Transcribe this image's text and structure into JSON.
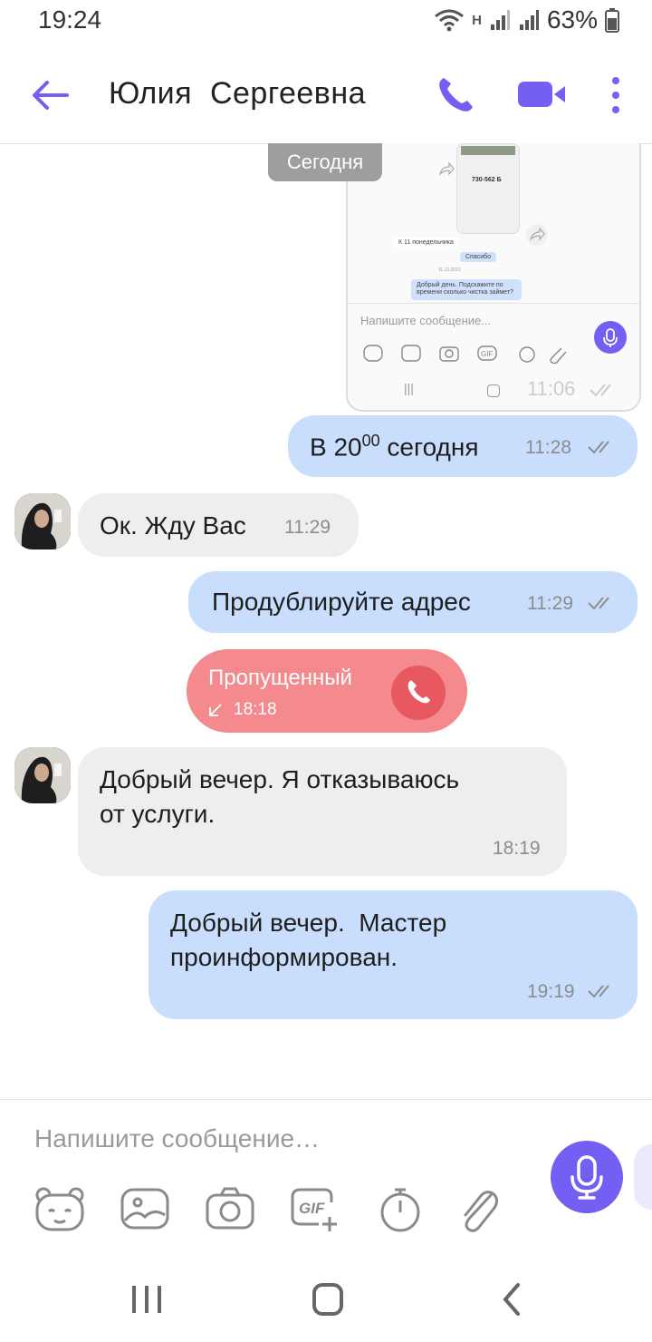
{
  "status_bar": {
    "time": "19:24",
    "battery": "63%",
    "network_label": "H"
  },
  "header": {
    "contact_name": "Юлия  Сергеевна"
  },
  "date_chip": "Сегодня",
  "attachment": {
    "messages": [
      "К 11 понедельника",
      "Спасибо",
      "Добрый день. Подскажите по времени сколько чистка займет?"
    ],
    "price": "730-562 Б",
    "date_label": "11.12.2021",
    "input_placeholder": "Напишите сообщение...",
    "timestamp": "11:06"
  },
  "messages": [
    {
      "direction": "out",
      "text_main": "В 20",
      "text_sup": "00",
      "text_rest": " сегодня",
      "time": "11:28"
    },
    {
      "direction": "in",
      "text": "Ок. Жду Вас",
      "time": "11:29"
    },
    {
      "direction": "out",
      "text": "Продублируйте адрес",
      "time": "11:29"
    },
    {
      "direction": "missed_call",
      "label": "Пропущенный",
      "time": "18:18"
    },
    {
      "direction": "in",
      "text_line1": "Добрый вечер. Я отказываюсь",
      "text_line2": "от услуги.",
      "time": "18:19"
    },
    {
      "direction": "out",
      "text_line1": "Добрый вечер.  Мастер",
      "text_line2": "проинформирован.",
      "time": "19:19"
    }
  ],
  "composer": {
    "placeholder": "Напишите сообщение…",
    "tools": [
      "sticker-icon",
      "gallery-icon",
      "camera-icon",
      "gif-icon",
      "timer-icon",
      "attachment-icon"
    ]
  },
  "colors": {
    "accent": "#7360f2",
    "outgoing": "#c9defc",
    "incoming": "#eeeeee",
    "missed": "#f48a8e"
  }
}
